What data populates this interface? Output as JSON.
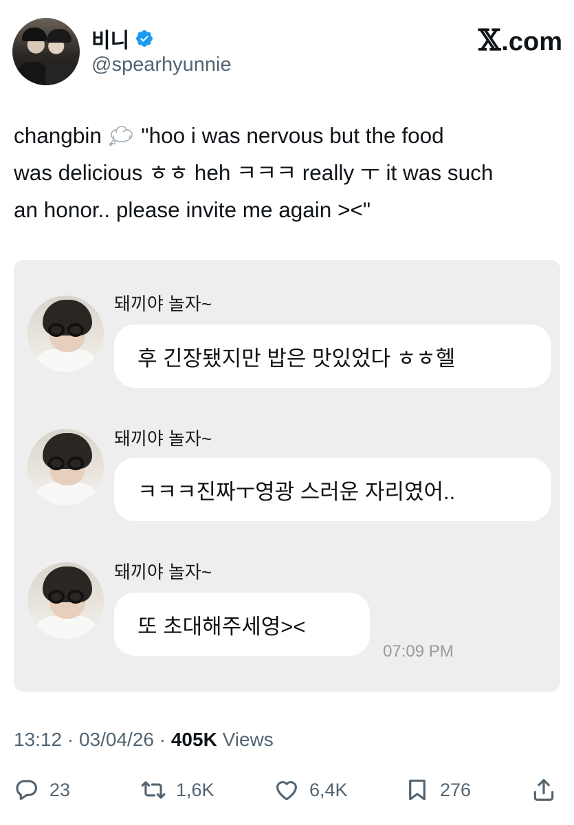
{
  "header": {
    "display_name": "비니",
    "handle": "@spearhyunnie",
    "site_logo_text": ".com"
  },
  "tweet": {
    "text_prefix": "changbin",
    "text_line1_rest": "\"hoo i was nervous but the food",
    "text_line2": "was delicious ㅎㅎ heh ㅋㅋㅋ really ㅜ it was such",
    "text_line3": "an honor.. please invite me again ><\""
  },
  "chat_screenshot": {
    "messages": [
      {
        "sender": "돼끼야 놀자~",
        "text": "후 긴장됐지만 밥은 맛있었다 ㅎㅎ헬"
      },
      {
        "sender": "돼끼야 놀자~",
        "text": "ㅋㅋㅋ진짜ㅜ영광 스러운 자리였어.."
      },
      {
        "sender": "돼끼야 놀자~",
        "text": "또 초대해주세영><"
      }
    ],
    "last_time": "07:09 PM"
  },
  "meta": {
    "time": "13:12",
    "sep1": " · ",
    "date": "03/04/26",
    "sep2": " · ",
    "views_count": "405K",
    "views_label": " Views"
  },
  "actions": {
    "replies": "23",
    "reposts": "1,6K",
    "likes": "6,4K",
    "bookmarks": "276"
  },
  "colors": {
    "verified": "#1d9bf0",
    "muted_text": "#536471",
    "card_bg": "#eeeeee"
  }
}
